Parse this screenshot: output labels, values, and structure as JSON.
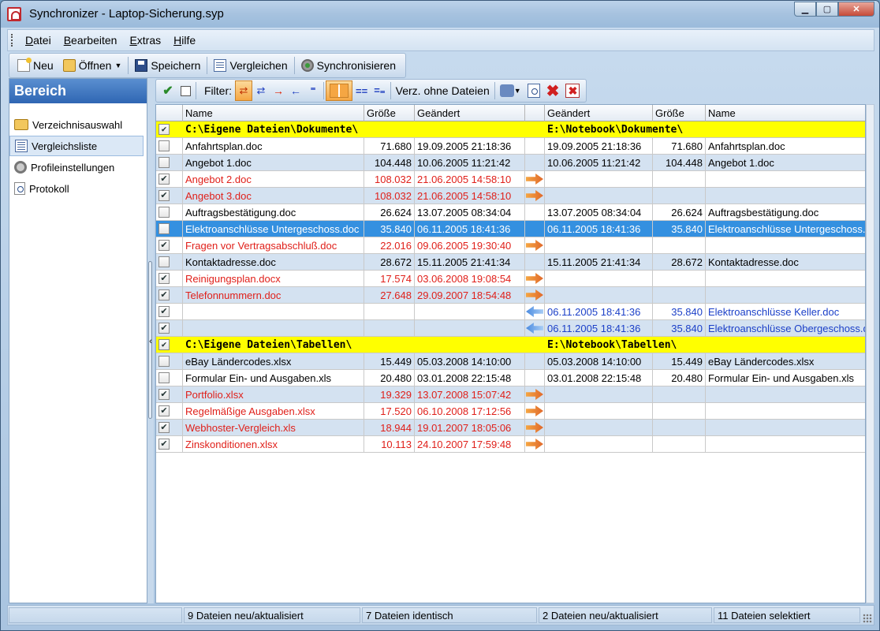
{
  "window": {
    "title": "Synchronizer - Laptop-Sicherung.syp"
  },
  "menu": [
    "Datei",
    "Bearbeiten",
    "Extras",
    "Hilfe"
  ],
  "toolbar": {
    "new_label": "Neu",
    "open_label": "Öffnen",
    "save_label": "Speichern",
    "compare_label": "Vergleichen",
    "sync_label": "Synchronisieren"
  },
  "sidebar": {
    "header": "Bereich",
    "items": [
      {
        "label": "Verzeichnisauswahl",
        "icon": "folder-icon",
        "active": false
      },
      {
        "label": "Vergleichsliste",
        "icon": "list-icon",
        "active": true
      },
      {
        "label": "Profileinstellungen",
        "icon": "gear-icon",
        "active": false
      },
      {
        "label": "Protokoll",
        "icon": "magnifier-icon",
        "active": false
      }
    ]
  },
  "filterbar": {
    "filter_label": "Filter:",
    "dir_without_files_label": "Verz. ohne Dateien"
  },
  "table": {
    "columns": [
      "Name",
      "Größe",
      "Geändert",
      "Geändert",
      "Größe",
      "Name"
    ],
    "rows": [
      {
        "type": "folder",
        "checked": true,
        "left_path": "C:\\Eigene Dateien\\Dokumente\\",
        "right_path": "E:\\Notebook\\Dokumente\\"
      },
      {
        "type": "file",
        "checked": false,
        "style": "normal",
        "left_name": "Anfahrtsplan.doc",
        "left_size": "71.680",
        "left_date": "19.09.2005 21:18:36",
        "dir": "",
        "right_date": "19.09.2005 21:18:36",
        "right_size": "71.680",
        "right_name": "Anfahrtsplan.doc"
      },
      {
        "type": "file",
        "checked": false,
        "style": "normal",
        "left_name": "Angebot 1.doc",
        "left_size": "104.448",
        "left_date": "10.06.2005 11:21:42",
        "dir": "",
        "right_date": "10.06.2005 11:21:42",
        "right_size": "104.448",
        "right_name": "Angebot 1.doc"
      },
      {
        "type": "file",
        "checked": true,
        "style": "red",
        "left_name": "Angebot 2.doc",
        "left_size": "108.032",
        "left_date": "21.06.2005 14:58:10",
        "dir": "right",
        "right_date": "",
        "right_size": "",
        "right_name": ""
      },
      {
        "type": "file",
        "checked": true,
        "style": "red",
        "left_name": "Angebot 3.doc",
        "left_size": "108.032",
        "left_date": "21.06.2005 14:58:10",
        "dir": "right",
        "right_date": "",
        "right_size": "",
        "right_name": ""
      },
      {
        "type": "file",
        "checked": false,
        "style": "normal",
        "left_name": "Auftragsbestätigung.doc",
        "left_size": "26.624",
        "left_date": "13.07.2005 08:34:04",
        "dir": "",
        "right_date": "13.07.2005 08:34:04",
        "right_size": "26.624",
        "right_name": "Auftragsbestätigung.doc"
      },
      {
        "type": "file",
        "checked": false,
        "style": "selected",
        "left_name": "Elektroanschlüsse Untergeschoss.doc",
        "left_size": "35.840",
        "left_date": "06.11.2005 18:41:36",
        "dir": "",
        "right_date": "06.11.2005 18:41:36",
        "right_size": "35.840",
        "right_name": "Elektroanschlüsse Untergeschoss.doc"
      },
      {
        "type": "file",
        "checked": true,
        "style": "red",
        "left_name": "Fragen vor Vertragsabschluß.doc",
        "left_size": "22.016",
        "left_date": "09.06.2005 19:30:40",
        "dir": "right",
        "right_date": "",
        "right_size": "",
        "right_name": ""
      },
      {
        "type": "file",
        "checked": false,
        "style": "normal",
        "left_name": "Kontaktadresse.doc",
        "left_size": "28.672",
        "left_date": "15.11.2005 21:41:34",
        "dir": "",
        "right_date": "15.11.2005 21:41:34",
        "right_size": "28.672",
        "right_name": "Kontaktadresse.doc"
      },
      {
        "type": "file",
        "checked": true,
        "style": "red",
        "left_name": "Reinigungsplan.docx",
        "left_size": "17.574",
        "left_date": "03.06.2008 19:08:54",
        "dir": "right",
        "right_date": "",
        "right_size": "",
        "right_name": ""
      },
      {
        "type": "file",
        "checked": true,
        "style": "red",
        "left_name": "Telefonnummern.doc",
        "left_size": "27.648",
        "left_date": "29.09.2007 18:54:48",
        "dir": "right",
        "right_date": "",
        "right_size": "",
        "right_name": ""
      },
      {
        "type": "file",
        "checked": true,
        "style": "blue",
        "left_name": "",
        "left_size": "",
        "left_date": "",
        "dir": "left",
        "right_date": "06.11.2005 18:41:36",
        "right_size": "35.840",
        "right_name": "Elektroanschlüsse Keller.doc"
      },
      {
        "type": "file",
        "checked": true,
        "style": "blue",
        "left_name": "",
        "left_size": "",
        "left_date": "",
        "dir": "left",
        "right_date": "06.11.2005 18:41:36",
        "right_size": "35.840",
        "right_name": "Elektroanschlüsse Obergeschoss.doc"
      },
      {
        "type": "folder",
        "checked": true,
        "left_path": "C:\\Eigene Dateien\\Tabellen\\",
        "right_path": "E:\\Notebook\\Tabellen\\"
      },
      {
        "type": "file",
        "checked": false,
        "style": "normal",
        "left_name": "eBay Ländercodes.xlsx",
        "left_size": "15.449",
        "left_date": "05.03.2008 14:10:00",
        "dir": "",
        "right_date": "05.03.2008 14:10:00",
        "right_size": "15.449",
        "right_name": "eBay Ländercodes.xlsx"
      },
      {
        "type": "file",
        "checked": false,
        "style": "normal",
        "left_name": "Formular Ein- und Ausgaben.xls",
        "left_size": "20.480",
        "left_date": "03.01.2008 22:15:48",
        "dir": "",
        "right_date": "03.01.2008 22:15:48",
        "right_size": "20.480",
        "right_name": "Formular Ein- und Ausgaben.xls"
      },
      {
        "type": "file",
        "checked": true,
        "style": "red",
        "left_name": "Portfolio.xlsx",
        "left_size": "19.329",
        "left_date": "13.07.2008 15:07:42",
        "dir": "right",
        "right_date": "",
        "right_size": "",
        "right_name": ""
      },
      {
        "type": "file",
        "checked": true,
        "style": "red",
        "left_name": "Regelmäßige Ausgaben.xlsx",
        "left_size": "17.520",
        "left_date": "06.10.2008 17:12:56",
        "dir": "right",
        "right_date": "",
        "right_size": "",
        "right_name": ""
      },
      {
        "type": "file",
        "checked": true,
        "style": "red",
        "left_name": "Webhoster-Vergleich.xls",
        "left_size": "18.944",
        "left_date": "19.01.2007 18:05:06",
        "dir": "right",
        "right_date": "",
        "right_size": "",
        "right_name": ""
      },
      {
        "type": "file",
        "checked": true,
        "style": "red",
        "left_name": "Zinskonditionen.xlsx",
        "left_size": "10.113",
        "left_date": "24.10.2007 17:59:48",
        "dir": "right",
        "right_date": "",
        "right_size": "",
        "right_name": ""
      }
    ]
  },
  "statusbar": {
    "left_new": "9 Dateien neu/aktualisiert",
    "identical": "7 Dateien identisch",
    "right_new": "2 Dateien neu/aktualisiert",
    "selected": "11 Dateien selektiert"
  }
}
